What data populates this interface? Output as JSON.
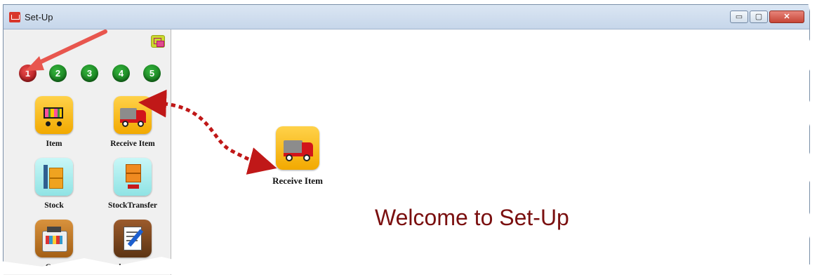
{
  "window": {
    "title": "Set-Up",
    "min_label": "▭",
    "max_label": "▢",
    "close_label": "✕"
  },
  "sidebar": {
    "pages": [
      {
        "label": "1",
        "color": "#b5121b",
        "active": true
      },
      {
        "label": "2",
        "color": "#1a8a22",
        "active": false
      },
      {
        "label": "3",
        "color": "#1a8a22",
        "active": false
      },
      {
        "label": "4",
        "color": "#1a8a22",
        "active": false
      },
      {
        "label": "5",
        "color": "#1a8a22",
        "active": false
      }
    ],
    "tiles": [
      {
        "label": "Item",
        "icon": "shopping-cart-icon"
      },
      {
        "label": "Receive Item",
        "icon": "delivery-truck-icon"
      },
      {
        "label": "Stock",
        "icon": "stock-shelf-icon"
      },
      {
        "label": "StockTransfer",
        "icon": "stock-transfer-icon"
      },
      {
        "label": "Cash",
        "icon": "cash-register-icon"
      },
      {
        "label": "Sales Invoice",
        "icon": "sales-invoice-icon"
      }
    ]
  },
  "main": {
    "featured_tile": {
      "label": "Receive Item",
      "icon": "delivery-truck-icon"
    },
    "welcome_text": "Welcome to Set-Up"
  },
  "colors": {
    "accent_red": "#c81a1a",
    "welcome_text": "#7a0f0f",
    "tile_yellow": "#f2a900"
  }
}
